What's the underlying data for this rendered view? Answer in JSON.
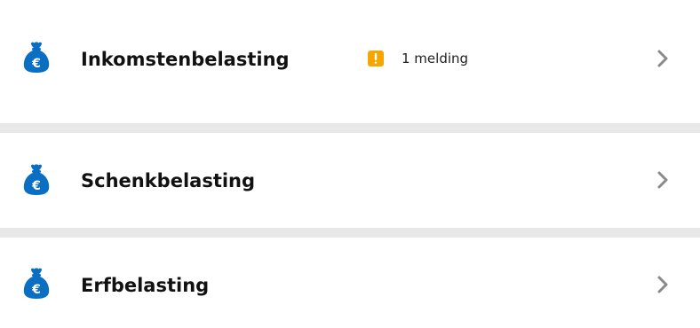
{
  "items": [
    {
      "icon": "money-bag-euro-icon",
      "title": "Inkomstenbelasting",
      "notice": {
        "icon": "warning-exclamation-icon",
        "text": "1 melding",
        "color": "#f5a600"
      }
    },
    {
      "icon": "money-bag-euro-icon",
      "title": "Schenkbelasting"
    },
    {
      "icon": "money-bag-euro-icon",
      "title": "Erfbelasting"
    }
  ],
  "colors": {
    "icon": "#0a6fc2",
    "chevron": "#8a8a8a",
    "separator": "#e8e8e8"
  }
}
